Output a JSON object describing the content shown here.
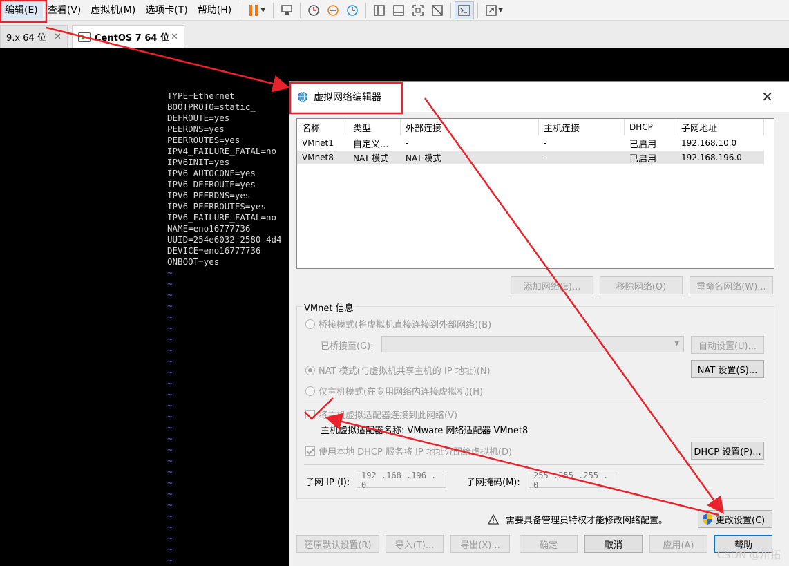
{
  "menubar": {
    "items": [
      "编辑(E)",
      "查看(V)",
      "虚拟机(M)",
      "选项卡(T)",
      "帮助(H)"
    ]
  },
  "tabs": [
    {
      "label": "9.x 64 位"
    },
    {
      "label": "CentOS 7 64 位"
    }
  ],
  "terminal": {
    "lines": [
      "TYPE=Ethernet",
      "BOOTPROTO=static_",
      "DEFROUTE=yes",
      "PEERDNS=yes",
      "PEERROUTES=yes",
      "IPV4_FAILURE_FATAL=no",
      "IPV6INIT=yes",
      "IPV6_AUTOCONF=yes",
      "IPV6_DEFROUTE=yes",
      "IPV6_PEERDNS=yes",
      "IPV6_PEERROUTES=yes",
      "IPV6_FAILURE_FATAL=no",
      "NAME=eno16777736",
      "UUID=254e6032-2580-4d4",
      "DEVICE=eno16777736",
      "ONBOOT=yes"
    ],
    "tilde_char": "~"
  },
  "dialog": {
    "title": "虚拟网络编辑器",
    "close_glyph": "✕",
    "columns": [
      "名称",
      "类型",
      "外部连接",
      "主机连接",
      "DHCP",
      "子网地址"
    ],
    "rows": [
      [
        "VMnet1",
        "自定义...",
        "-",
        "-",
        "已启用",
        "192.168.10.0"
      ],
      [
        "VMnet8",
        "NAT 模式",
        "NAT 模式",
        "-",
        "已启用",
        "192.168.196.0"
      ]
    ],
    "list_buttons": {
      "add": "添加网络(E)...",
      "remove": "移除网络(O)",
      "rename": "重命名网络(W)..."
    },
    "vmnet_info": {
      "label": "VMnet 信息",
      "bridged": "桥接模式(将虚拟机直接连接到外部网络)(B)",
      "bridged_to_label": "已桥接至(G):",
      "auto_settings": "自动设置(U)...",
      "nat": "NAT 模式(与虚拟机共享主机的 IP 地址)(N)",
      "nat_settings": "NAT 设置(S)...",
      "host_only": "仅主机模式(在专用网络内连接虚拟机)(H)",
      "connect_host_adapter": "将主机虚拟适配器连接到此网络(V)",
      "adapter_name": "主机虚拟适配器名称: VMware 网络适配器 VMnet8",
      "use_dhcp": "使用本地 DHCP 服务将 IP 地址分配给虚拟机(D)",
      "dhcp_settings": "DHCP 设置(P)...",
      "subnet_ip_label": "子网 IP (I):",
      "subnet_ip": "192 .168 .196 . 0",
      "subnet_mask_label": "子网掩码(M):",
      "subnet_mask": "255 .255 .255 . 0"
    },
    "admin_warning": "需要具备管理员特权才能修改网络配置。",
    "change_settings": "更改设置(C)",
    "bottom_buttons": {
      "restore": "还原默认设置(R)",
      "import": "导入(T)...",
      "export": "导出(X)...",
      "ok": "确定",
      "cancel": "取消",
      "apply": "应用(A)",
      "help": "帮助"
    }
  },
  "watermark": "CSDN @卅拓",
  "colors": {
    "annotation_red": "#e8232b",
    "tilde_blue": "#4b6bff",
    "accent": "#0078d7"
  }
}
